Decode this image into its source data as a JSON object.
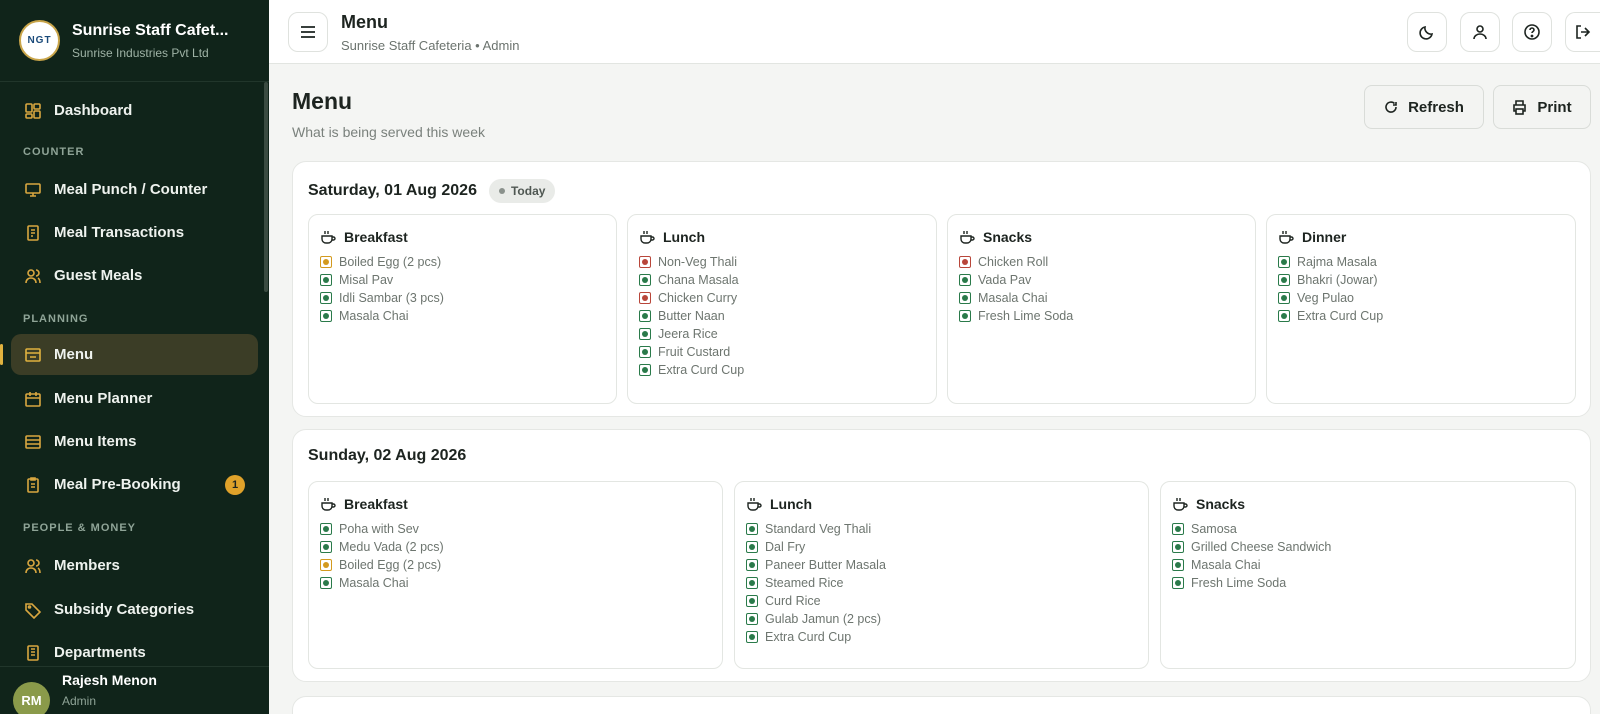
{
  "sidebar": {
    "brand_title": "Sunrise Staff Cafet...",
    "brand_sub": "Sunrise Industries Pvt Ltd",
    "logo_text": "NGT",
    "items": {
      "dashboard": "Dashboard",
      "sec_counter": "COUNTER",
      "meal_punch": "Meal Punch / Counter",
      "meal_transactions": "Meal Transactions",
      "guest_meals": "Guest Meals",
      "sec_planning": "PLANNING",
      "menu": "Menu",
      "menu_planner": "Menu Planner",
      "menu_items": "Menu Items",
      "meal_prebooking": "Meal Pre-Booking",
      "prebooking_badge": "1",
      "sec_people": "PEOPLE & MONEY",
      "members": "Members",
      "subsidy": "Subsidy Categories",
      "departments": "Departments"
    },
    "user": {
      "initials": "RM",
      "name": "Rajesh Menon",
      "role": "Admin"
    }
  },
  "topbar": {
    "title": "Menu",
    "subtitle": "Sunrise Staff Cafeteria • Admin"
  },
  "main": {
    "title": "Menu",
    "subtitle": "What is being served this week",
    "refresh_label": "Refresh",
    "print_label": "Print"
  },
  "days": [
    {
      "title": "Saturday, 01 Aug 2026",
      "badge": "Today",
      "meals": [
        {
          "name": "Breakfast",
          "items": [
            {
              "label": "Boiled Egg (2 pcs)",
              "type": "egg"
            },
            {
              "label": "Misal Pav",
              "type": "veg"
            },
            {
              "label": "Idli Sambar (3 pcs)",
              "type": "veg"
            },
            {
              "label": "Masala Chai",
              "type": "veg"
            }
          ]
        },
        {
          "name": "Lunch",
          "items": [
            {
              "label": "Non-Veg Thali",
              "type": "nonveg"
            },
            {
              "label": "Chana Masala",
              "type": "veg"
            },
            {
              "label": "Chicken Curry",
              "type": "nonveg"
            },
            {
              "label": "Butter Naan",
              "type": "veg"
            },
            {
              "label": "Jeera Rice",
              "type": "veg"
            },
            {
              "label": "Fruit Custard",
              "type": "veg"
            },
            {
              "label": "Extra Curd Cup",
              "type": "veg"
            }
          ]
        },
        {
          "name": "Snacks",
          "items": [
            {
              "label": "Chicken Roll",
              "type": "nonveg"
            },
            {
              "label": "Vada Pav",
              "type": "veg"
            },
            {
              "label": "Masala Chai",
              "type": "veg"
            },
            {
              "label": "Fresh Lime Soda",
              "type": "veg"
            }
          ]
        },
        {
          "name": "Dinner",
          "items": [
            {
              "label": "Rajma Masala",
              "type": "veg"
            },
            {
              "label": "Bhakri (Jowar)",
              "type": "veg"
            },
            {
              "label": "Veg Pulao",
              "type": "veg"
            },
            {
              "label": "Extra Curd Cup",
              "type": "veg"
            }
          ]
        }
      ]
    },
    {
      "title": "Sunday, 02 Aug 2026",
      "meals": [
        {
          "name": "Breakfast",
          "items": [
            {
              "label": "Poha with Sev",
              "type": "veg"
            },
            {
              "label": "Medu Vada (2 pcs)",
              "type": "veg"
            },
            {
              "label": "Boiled Egg (2 pcs)",
              "type": "egg"
            },
            {
              "label": "Masala Chai",
              "type": "veg"
            }
          ]
        },
        {
          "name": "Lunch",
          "items": [
            {
              "label": "Standard Veg Thali",
              "type": "veg"
            },
            {
              "label": "Dal Fry",
              "type": "veg"
            },
            {
              "label": "Paneer Butter Masala",
              "type": "veg"
            },
            {
              "label": "Steamed Rice",
              "type": "veg"
            },
            {
              "label": "Curd Rice",
              "type": "veg"
            },
            {
              "label": "Gulab Jamun (2 pcs)",
              "type": "veg"
            },
            {
              "label": "Extra Curd Cup",
              "type": "veg"
            }
          ]
        },
        {
          "name": "Snacks",
          "items": [
            {
              "label": "Samosa",
              "type": "veg"
            },
            {
              "label": "Grilled Cheese Sandwich",
              "type": "veg"
            },
            {
              "label": "Masala Chai",
              "type": "veg"
            },
            {
              "label": "Fresh Lime Soda",
              "type": "veg"
            }
          ]
        }
      ]
    }
  ]
}
